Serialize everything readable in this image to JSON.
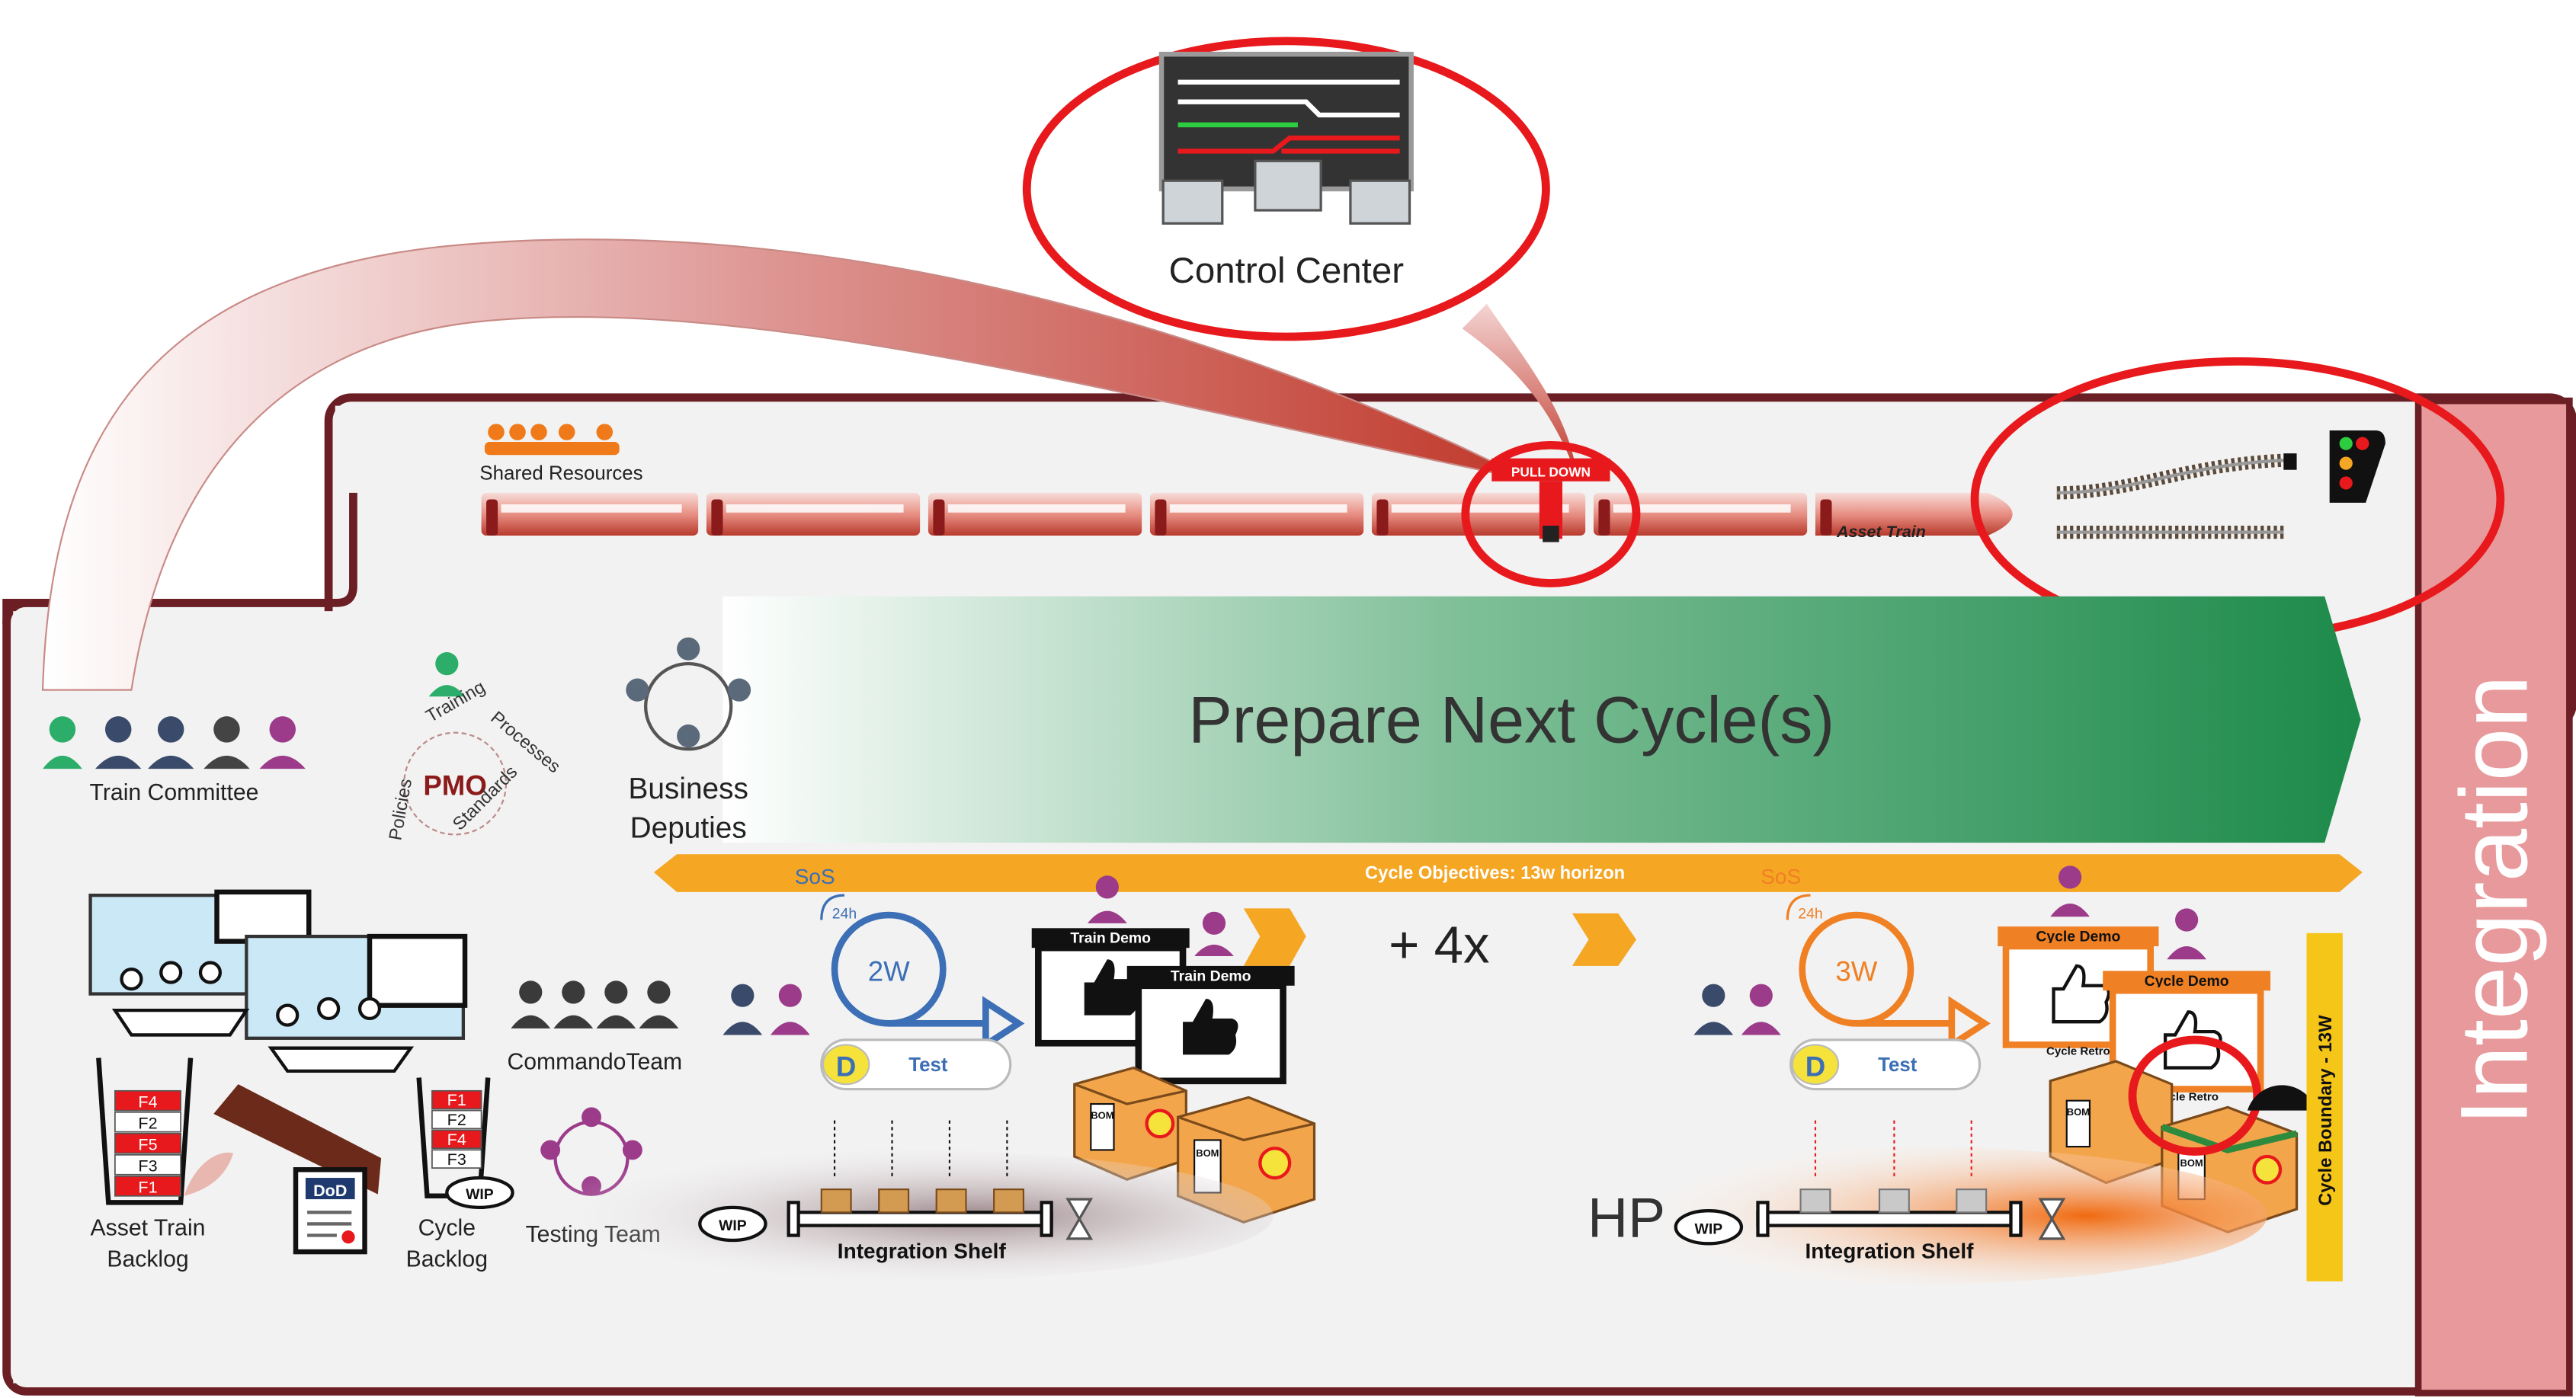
{
  "control_center": {
    "label": "Control Center"
  },
  "train": {
    "shared_resources": "Shared Resources",
    "pull_down": "PULL DOWN",
    "asset_train": "Asset Train"
  },
  "banner": {
    "prepare": "Prepare Next Cycle(s)"
  },
  "objectives": {
    "text": "Cycle Objectives: 13w horizon"
  },
  "side": {
    "integration": "Integration"
  },
  "left": {
    "train_committee": "Train Committee",
    "pmo": "PMO",
    "pmo_ring_words": [
      "Training",
      "Processes",
      "Standards",
      "Policies"
    ],
    "business_deputies_1": "Business",
    "business_deputies_2": "Deputies",
    "commando_team": "CommandoTeam",
    "testing_team": "Testing Team",
    "asset_backlog_1": "Asset Train",
    "asset_backlog_2": "Backlog",
    "cycle_backlog_1": "Cycle",
    "cycle_backlog_2": "Backlog",
    "asset_features": [
      "F4",
      "F2",
      "F5",
      "F3",
      "F1"
    ],
    "cycle_features": [
      "F1",
      "F2",
      "F4",
      "F3"
    ],
    "wip": "WIP",
    "dod": "DoD"
  },
  "cycle_a": {
    "sos": "SoS",
    "hours": "24h",
    "duration": "2W",
    "d": "D",
    "test": "Test",
    "demo1": "Train Demo",
    "demo2": "Train Demo",
    "shelf": "Integration Shelf",
    "wip": "WIP",
    "bom": "BOM"
  },
  "repeat": {
    "label": "+ 4x"
  },
  "cycle_b": {
    "sos": "SoS",
    "hours": "24h",
    "duration": "3W",
    "d": "D",
    "test": "Test",
    "demo1": "Cycle Demo",
    "demo2": "Cycle Demo",
    "retro1": "Cycle Retro",
    "retro2": "Cycle Retro",
    "shelf": "Integration Shelf",
    "wip": "WIP",
    "hp": "HP",
    "boundary": "Cycle Boundary - 13W",
    "bom": "BOM"
  },
  "colors": {
    "red": "#e8191c",
    "train": "#c0392b",
    "integration": "#e8999b",
    "green": "#1c8a4a",
    "orange": "#f5a623",
    "cycle_blue": "#3c6fb5",
    "cycle_orange": "#f08024",
    "purple": "#9b3b8a"
  },
  "icons": [
    "monitor-icon",
    "person-icon",
    "thumbs-up-icon",
    "box-icon",
    "hourglass-icon",
    "rail-track-icon",
    "signal-light-icon",
    "document-icon",
    "cycle-arrow-icon"
  ]
}
